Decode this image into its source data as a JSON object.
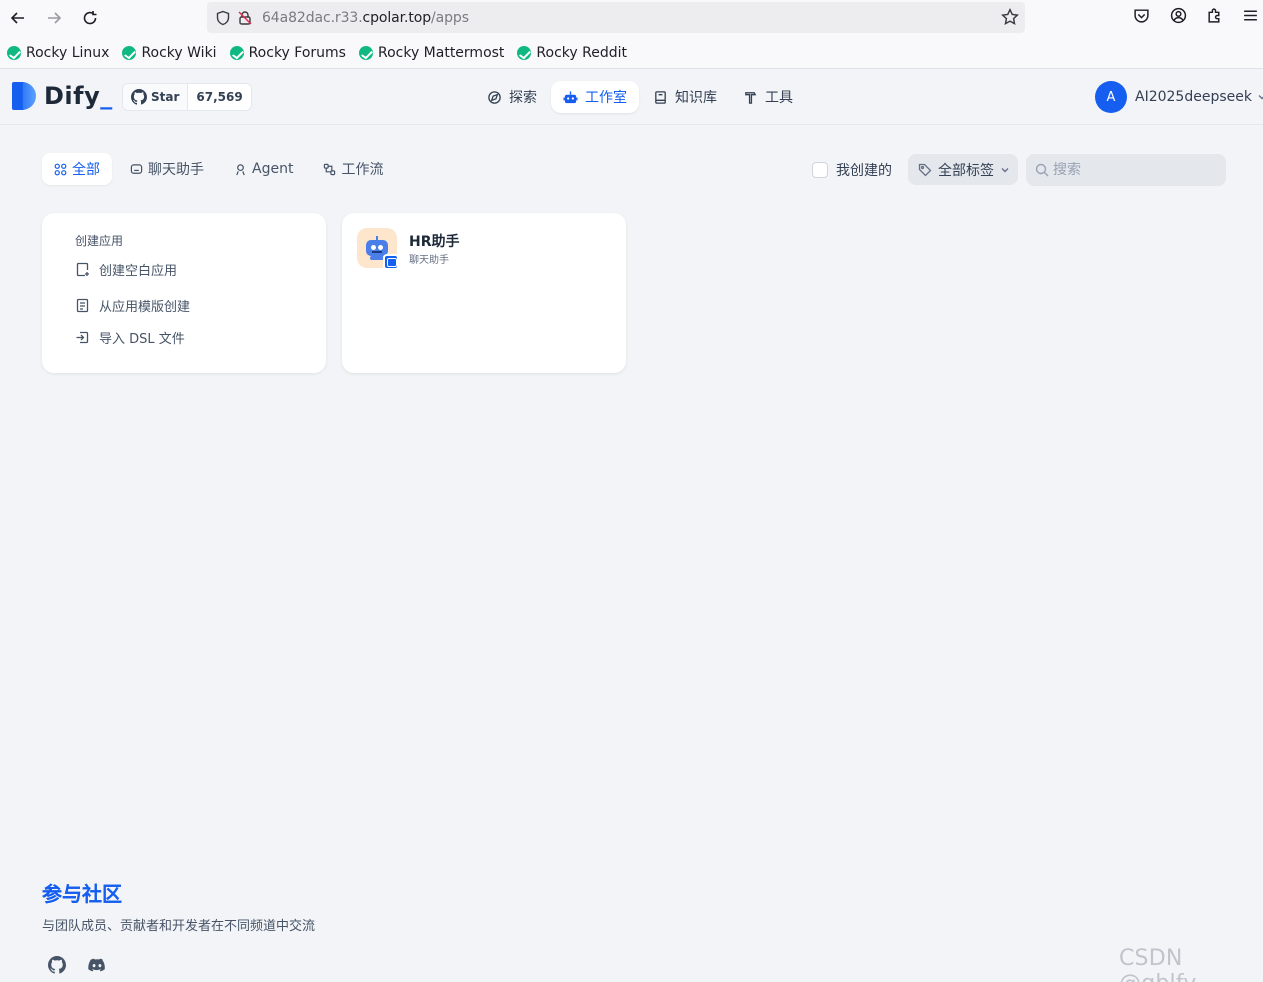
{
  "browser": {
    "url_prefix": "64a82dac.r33.",
    "url_host": "cpolar.top",
    "url_path": "/apps",
    "bookmarks": [
      "Rocky Linux",
      "Rocky Wiki",
      "Rocky Forums",
      "Rocky Mattermost",
      "Rocky Reddit"
    ]
  },
  "header": {
    "logo": "Dify",
    "star_label": "Star",
    "star_count": "67,569",
    "nav": [
      {
        "label": "探索",
        "icon": "compass-icon"
      },
      {
        "label": "工作室",
        "icon": "robot-icon",
        "active": true
      },
      {
        "label": "知识库",
        "icon": "book-icon"
      },
      {
        "label": "工具",
        "icon": "hammer-icon"
      }
    ],
    "user_initial": "A",
    "user_name": "AI2025deepseek"
  },
  "filters": {
    "tabs": [
      {
        "label": "全部",
        "icon": "grid-icon",
        "active": true
      },
      {
        "label": "聊天助手",
        "icon": "chat-icon"
      },
      {
        "label": "Agent",
        "icon": "agent-icon"
      },
      {
        "label": "工作流",
        "icon": "workflow-icon"
      }
    ],
    "mine_label": "我创建的",
    "tag_label": "全部标签",
    "search_placeholder": "搜索"
  },
  "create_card": {
    "title": "创建应用",
    "items": [
      "创建空白应用",
      "从应用模版创建",
      "导入 DSL 文件"
    ]
  },
  "apps": [
    {
      "name": "HR助手",
      "type": "聊天助手"
    }
  ],
  "community": {
    "title": "参与社区",
    "description": "与团队成员、贡献者和开发者在不同频道中交流"
  },
  "watermark": "CSDN @gblfy",
  "colors": {
    "accent": "#155eef",
    "background": "#f2f4f7"
  }
}
